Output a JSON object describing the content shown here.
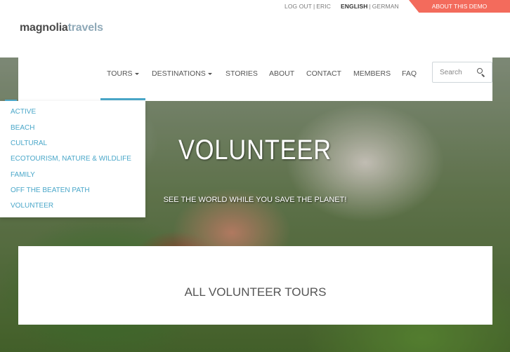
{
  "topbar": {
    "logout": "LOG OUT",
    "user": "ERIC",
    "lang_english": "ENGLISH",
    "lang_german": "GERMAN",
    "about_demo": "ABOUT THIS DEMO"
  },
  "logo": {
    "part1": "magnolia",
    "part2": "travels"
  },
  "nav": {
    "items": [
      {
        "label": "TOURS",
        "dropdown": true
      },
      {
        "label": "DESTINATIONS",
        "dropdown": true
      },
      {
        "label": "STORIES",
        "dropdown": false
      },
      {
        "label": "ABOUT",
        "dropdown": false
      },
      {
        "label": "CONTACT",
        "dropdown": false
      },
      {
        "label": "MEMBERS",
        "dropdown": false
      },
      {
        "label": "FAQ",
        "dropdown": false
      }
    ],
    "search_placeholder": "Search"
  },
  "dropdown": {
    "items": [
      "ACTIVE",
      "BEACH",
      "CULTURAL",
      "ECOTOURISM, NATURE & WILDLIFE",
      "FAMILY",
      "OFF THE BEATEN PATH",
      "VOLUNTEER"
    ]
  },
  "hero": {
    "title": "VOLUNTEER",
    "subtitle": "SEE THE WORLD WHILE YOU SAVE THE PLANET!"
  },
  "panel": {
    "title": "ALL VOLUNTEER TOURS"
  },
  "colors": {
    "accent": "#4aa7c9",
    "demo_tab": "#f36b5c"
  }
}
